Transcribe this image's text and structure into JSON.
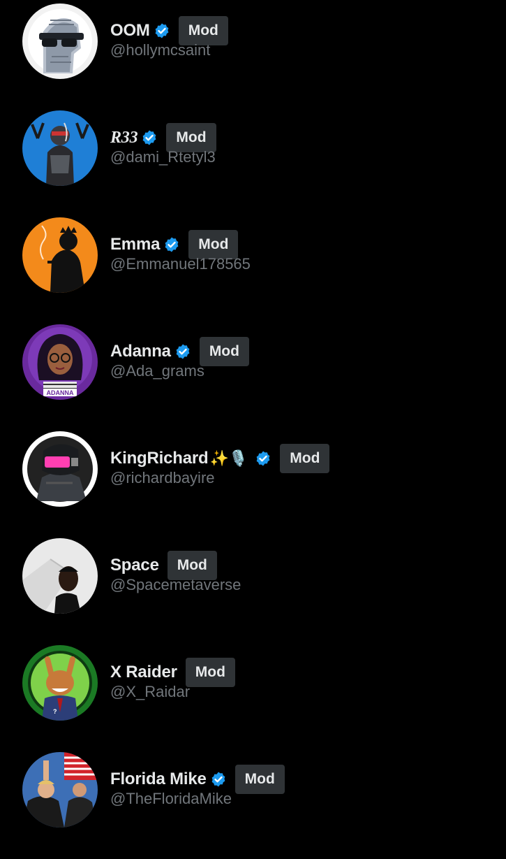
{
  "mods_list": {
    "users": [
      {
        "display_name": "OOM",
        "handle": "@hollymcsaint",
        "verified": true,
        "role_label": "Mod",
        "avatar": "avatar-oom"
      },
      {
        "display_name": "R33",
        "handle": "@dami_Rtetyl3",
        "verified": true,
        "role_label": "Mod",
        "avatar": "avatar-r33"
      },
      {
        "display_name": "Emma",
        "handle": "@Emmanuel178565",
        "verified": true,
        "role_label": "Mod",
        "avatar": "avatar-emma"
      },
      {
        "display_name": "Adanna",
        "handle": "@Ada_grams",
        "verified": true,
        "role_label": "Mod",
        "avatar": "avatar-adanna",
        "avatar_caption": "ADANNA"
      },
      {
        "display_name": "KingRichard",
        "name_emoji": "✨🎙️",
        "handle": "@richardbayire",
        "verified": true,
        "role_label": "Mod",
        "avatar": "avatar-kingrichard"
      },
      {
        "display_name": "Space",
        "handle": "@Spacemetaverse",
        "verified": false,
        "role_label": "Mod",
        "avatar": "avatar-space"
      },
      {
        "display_name": "X Raider",
        "handle": "@X_Raidar",
        "verified": false,
        "role_label": "Mod",
        "avatar": "avatar-xraider",
        "avatar_mark": "?"
      },
      {
        "display_name": "Florida Mike",
        "handle": "@TheFloridaMike",
        "verified": true,
        "role_label": "Mod",
        "avatar": "avatar-floridamike"
      }
    ]
  },
  "colors": {
    "background": "#000000",
    "name_text": "#e7e9ea",
    "handle_text": "#71767b",
    "mod_chip_bg": "#2f3336",
    "verified_badge": "#1d9bf0"
  }
}
